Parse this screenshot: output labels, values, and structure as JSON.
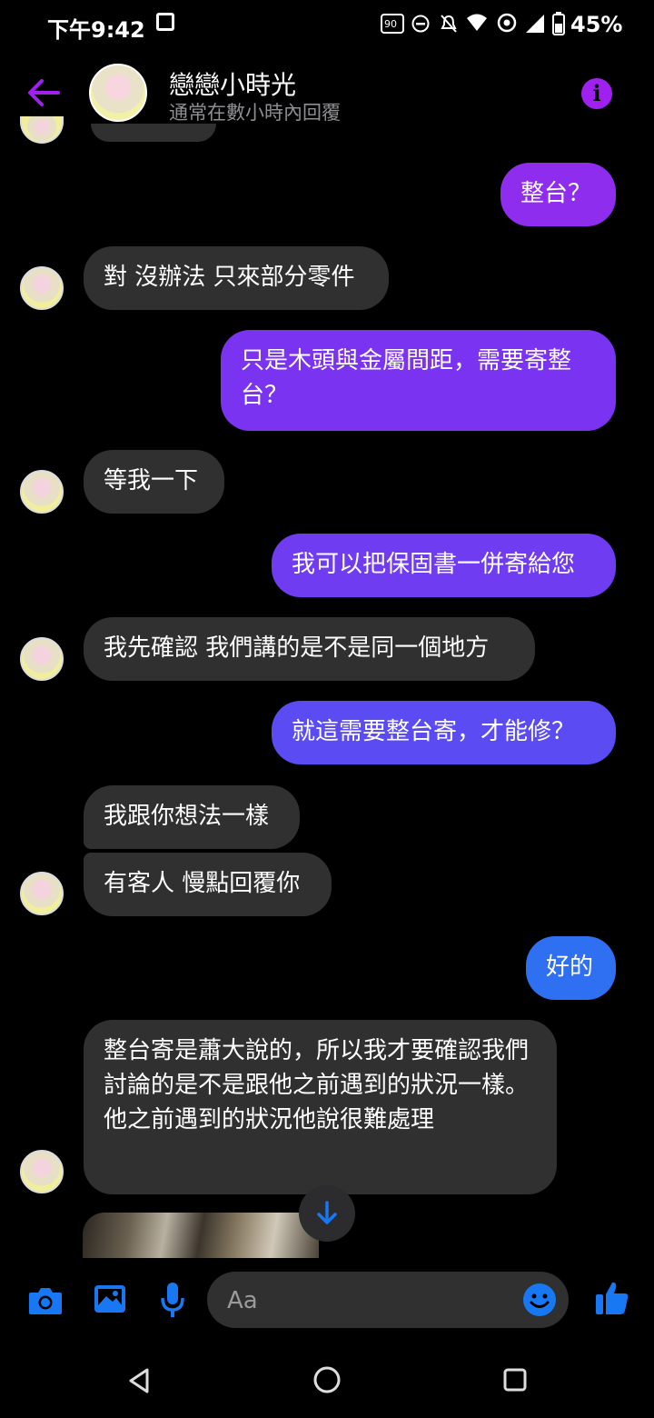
{
  "status_bar": {
    "time": "下午9:42",
    "refresh_rate": "90",
    "battery": "45%"
  },
  "header": {
    "title": "戀戀小時光",
    "subtitle": "通常在數小時內回覆"
  },
  "messages": [
    {
      "side": "out",
      "text": "整台？",
      "color": "#8e2ded"
    },
    {
      "side": "in",
      "text": "對 沒辦法 只來部分零件"
    },
    {
      "side": "out",
      "text": "只是木頭與金屬間距，需要寄整台？",
      "color": "#7a33f0"
    },
    {
      "side": "in",
      "text": "等我一下"
    },
    {
      "side": "out",
      "text": "我可以把保固書一併寄給您",
      "color": "#6f3cf2"
    },
    {
      "side": "in",
      "text": "我先確認 我們講的是不是同一個地方"
    },
    {
      "side": "out",
      "text": "就這需要整台寄，才能修？",
      "color": "#5a4cf2"
    },
    {
      "side": "in",
      "text": "我跟你想法一樣"
    },
    {
      "side": "in",
      "text": "有客人 慢點回覆你"
    },
    {
      "side": "out",
      "text": "好的",
      "color": "#2f6ff1"
    },
    {
      "side": "in",
      "text": "整台寄是蕭大說的，所以我才要確認我們討論的是不是跟他之前遇到的狀況一樣。\n他之前遇到的狀況他說很難處理"
    }
  ],
  "composer": {
    "placeholder": "Aa"
  },
  "colors": {
    "accent": "#a020f0",
    "blue": "#1877f2",
    "incoming_bubble": "#303030"
  }
}
